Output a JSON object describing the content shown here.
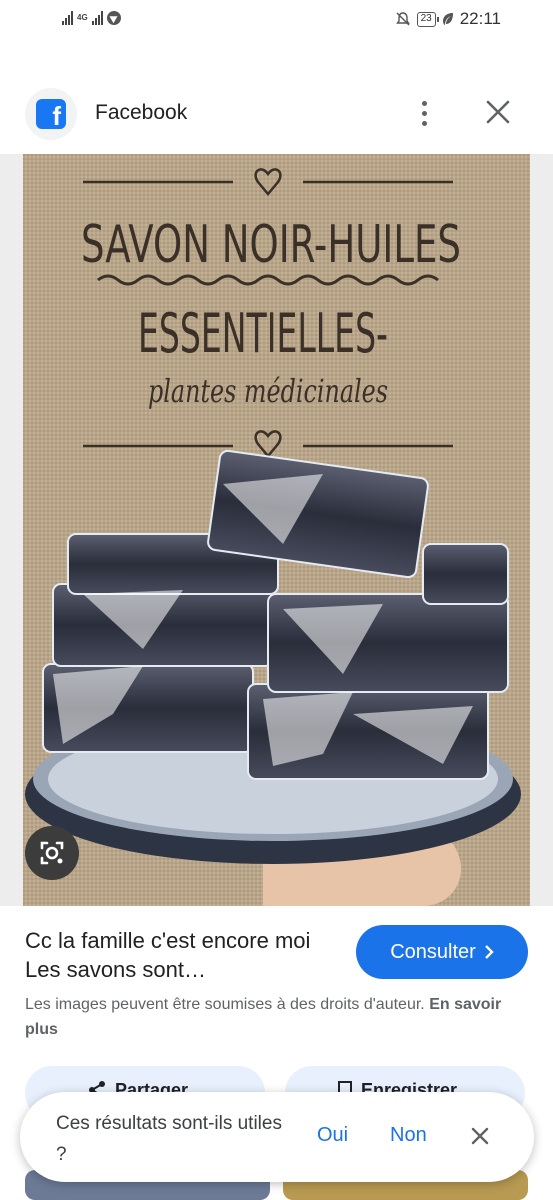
{
  "status_bar": {
    "network": "4G",
    "battery": "23",
    "time": "22:11"
  },
  "header": {
    "site_name": "Facebook",
    "logo_letter": "f",
    "icons": [
      "facebook-logo-icon",
      "more-vert-icon",
      "close-icon"
    ]
  },
  "image": {
    "line1": "SAVON NOIR-HUILES",
    "line2": "ESSENTIELLES-",
    "line3": "plantes médicinales"
  },
  "result": {
    "title": "Cc la famille c'est encore moi Les savons sont…",
    "consult_label": "Consulter",
    "copyright_text": "Les images peuvent être soumises à des droits d'auteur.",
    "copyright_link": "En savoir plus"
  },
  "actions": {
    "share_label": "Partager",
    "save_label": "Enregistrer"
  },
  "feedback": {
    "question": "Ces résultats sont-ils utiles ?",
    "yes": "Oui",
    "no": "Non"
  },
  "colors": {
    "accent": "#1a73e8",
    "facebook": "#1877f2",
    "chip_bg": "#e8f0fe"
  }
}
